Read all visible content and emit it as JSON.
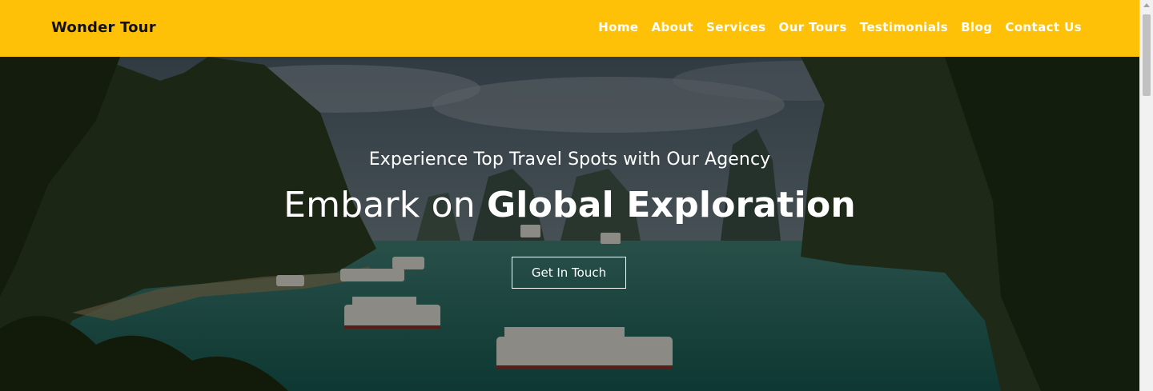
{
  "header": {
    "brand": "Wonder Tour",
    "nav": [
      "Home",
      "About",
      "Services",
      "Our Tours",
      "Testimonials",
      "Blog",
      "Contact Us"
    ]
  },
  "hero": {
    "tagline": "Experience Top Travel Spots with Our Agency",
    "headline_regular": "Embark on",
    "headline_bold": "Global Exploration",
    "cta_label": "Get In Touch",
    "background_image": "bay-with-limestone-islands-and-boats"
  },
  "colors": {
    "navbar": "#ffc107",
    "brand_text": "#111111",
    "nav_text": "#ffffff",
    "hero_text": "#ffffff"
  }
}
